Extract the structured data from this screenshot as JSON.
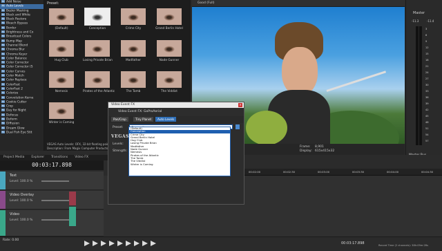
{
  "fx_list": {
    "items": [
      {
        "label": "Add Noise"
      },
      {
        "label": "Auto Levels",
        "selected": true
      },
      {
        "label": "Bezier Masking"
      },
      {
        "label": "Black and White"
      },
      {
        "label": "Black Restore"
      },
      {
        "label": "Bleach Bypass"
      },
      {
        "label": "Border"
      },
      {
        "label": "Brightness and Co"
      },
      {
        "label": "Broadcast Colors"
      },
      {
        "label": "Bump Map"
      },
      {
        "label": "Channel Blend"
      },
      {
        "label": "Chroma Blur"
      },
      {
        "label": "Chroma Keyer"
      },
      {
        "label": "Color Balance"
      },
      {
        "label": "Color Corrector"
      },
      {
        "label": "Color Corrector (S"
      },
      {
        "label": "Color Curves"
      },
      {
        "label": "Color Match"
      },
      {
        "label": "Color Replace"
      },
      {
        "label": "ColorFast"
      },
      {
        "label": "ColorFast 2"
      },
      {
        "label": "Colorize"
      },
      {
        "label": "Convolution Kerne"
      },
      {
        "label": "Cookie Cutter"
      },
      {
        "label": "Crop"
      },
      {
        "label": "Day for Night"
      },
      {
        "label": "Defocus"
      },
      {
        "label": "Deform"
      },
      {
        "label": "Diffusion"
      },
      {
        "label": "Dream Glow"
      },
      {
        "label": "Dual Fish Eye Stit"
      }
    ]
  },
  "presets": {
    "header": "Preset:",
    "items": [
      {
        "label": "(Default)"
      },
      {
        "label": "Conception",
        "selected": true
      },
      {
        "label": "Crime City"
      },
      {
        "label": "Grand Berlin Hotel"
      },
      {
        "label": "Hug Club"
      },
      {
        "label": "Losing Private Brian"
      },
      {
        "label": "Madfather"
      },
      {
        "label": "Nade Gunner"
      },
      {
        "label": "Nemesis"
      },
      {
        "label": "Pirates of the Atlantic"
      },
      {
        "label": "The Tomb"
      },
      {
        "label": "The Viddist"
      },
      {
        "label": "Winter is Coming"
      }
    ]
  },
  "fx_info": {
    "line1": "VEGAS Auto Levels: OFX, 32-bit floating point, GPU Accelerated",
    "line2": "Description: From Magix Computer Products Intl. Co."
  },
  "preview": {
    "toolbar": "Good (Full)",
    "project": "Project:",
    "frame_label": "Frame:",
    "frame_value": "8,901",
    "display_label": "Display:",
    "display_value": "615x415x32"
  },
  "master": {
    "title": "Master",
    "levels": [
      "-11.3",
      "-11.4"
    ],
    "scale": [
      "3",
      "6",
      "9",
      "12",
      "15",
      "18",
      "21",
      "24",
      "27",
      "30",
      "33",
      "36",
      "39",
      "42",
      "45",
      "48",
      "51",
      "54",
      "57"
    ],
    "bus_label": "Master Bus"
  },
  "tabs": [
    "Project Media",
    "Explorer",
    "Transitions",
    "Video FX"
  ],
  "timecode": "00:03:17.898",
  "tracks": [
    {
      "name": "Text",
      "level": "Level: 100.0 %",
      "color": "#4aa8c0"
    },
    {
      "name": "Video Overlay",
      "level": "Level: 100.0 %",
      "color": "#8a4a8a"
    },
    {
      "name": "Video",
      "level": "Level: 100.0 %",
      "color": "#3aa88a"
    }
  ],
  "ruler": [
    "00:00:00",
    "00:00:30",
    "00:01:00",
    "00:01:30",
    "00:02:00",
    "00:02:30",
    "00:03:00",
    "00:03:30",
    "00:04:00",
    "00:04:30"
  ],
  "dialog": {
    "title": "Video Event FX",
    "subtitle": "Video Event FX: GoProAerial",
    "chain": [
      "Pan/Crop",
      "Tiny Planet",
      "Auto Levels"
    ],
    "preset_label": "Preset:",
    "preset_value": "Conception",
    "brand": "VEGAS",
    "param1": "Levels:",
    "param2": "Strength:"
  },
  "dropdown": {
    "items": [
      "(Default)",
      "Conception",
      "Crime City",
      "Grand Berlin Hotel",
      "Hug Club",
      "Losing Private Brian",
      "Madfather",
      "Nade Gunner",
      "Nemesis",
      "Pirates of the Atlantic",
      "The Tomb",
      "The Viddist",
      "Winter is Coming"
    ],
    "selected_index": 1
  },
  "status": {
    "rate": "Rate: 0.00",
    "end_time": "00:03:17.898",
    "record": "Record Time (2 channels): 38h:09m:28s"
  }
}
